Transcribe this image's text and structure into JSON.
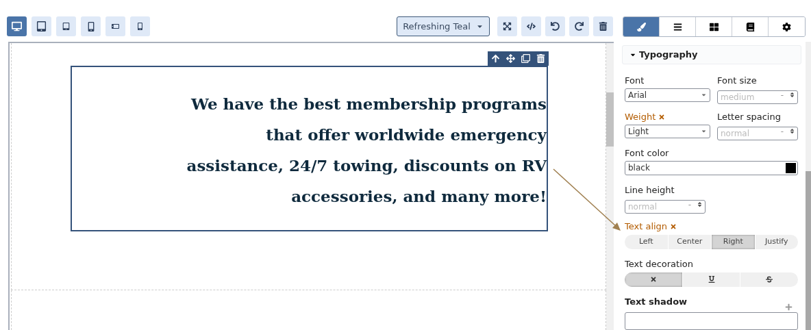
{
  "device_buttons": [
    {
      "kind": "desktop",
      "selected": true
    },
    {
      "kind": "tablet",
      "selected": false
    },
    {
      "kind": "tablet-small",
      "selected": false
    },
    {
      "kind": "phone",
      "selected": false
    },
    {
      "kind": "phone-landscape",
      "selected": false
    },
    {
      "kind": "phone-small",
      "selected": false
    }
  ],
  "theme_dropdown": {
    "value": "Refreshing Teal"
  },
  "toolbar": [
    {
      "kind": "fullscreen"
    },
    {
      "kind": "code"
    },
    {
      "kind": "undo"
    },
    {
      "kind": "redo"
    },
    {
      "kind": "delete"
    }
  ],
  "panel_tabs": [
    {
      "kind": "style",
      "selected": true
    },
    {
      "kind": "layers",
      "selected": false
    },
    {
      "kind": "blocks",
      "selected": false
    },
    {
      "kind": "pages",
      "selected": false
    },
    {
      "kind": "settings",
      "selected": false
    }
  ],
  "canvas": {
    "block_toolbar": [
      {
        "kind": "up"
      },
      {
        "kind": "move"
      },
      {
        "kind": "clone"
      },
      {
        "kind": "delete"
      }
    ],
    "text_block": {
      "text": "We have the best membership programs that offer worldwide emergency assistance, 24/7 towing, discounts on RV accessories, and many more!",
      "selected": true
    }
  },
  "typography": {
    "title": "Typography",
    "expanded": true,
    "rows": [
      [
        {
          "kind": "select",
          "label": "Font",
          "modified": false,
          "value": "Arial"
        },
        {
          "kind": "number",
          "label": "Font size",
          "modified": false,
          "placeholder": "medium",
          "unit": "-"
        }
      ],
      [
        {
          "kind": "select",
          "label": "Weight",
          "modified": true,
          "value": "Light"
        },
        {
          "kind": "number",
          "label": "Letter spacing",
          "modified": false,
          "placeholder": "normal",
          "unit": "-"
        }
      ],
      [
        {
          "kind": "color",
          "label": "Font color",
          "modified": false,
          "value": "black",
          "color": "#000000"
        }
      ],
      [
        {
          "kind": "number",
          "label": "Line height",
          "modified": false,
          "placeholder": "normal",
          "unit": "-"
        }
      ],
      [
        {
          "kind": "radio",
          "label": "Text align",
          "modified": true,
          "options": [
            {
              "label": "Left",
              "selected": false
            },
            {
              "label": "Center",
              "selected": false
            },
            {
              "label": "Right",
              "selected": true
            },
            {
              "label": "Justify",
              "selected": false
            }
          ]
        }
      ],
      [
        {
          "kind": "icon-radio",
          "label": "Text decoration",
          "modified": false,
          "options": [
            {
              "kind": "none",
              "selected": true
            },
            {
              "kind": "underline",
              "selected": false
            },
            {
              "kind": "strikethrough",
              "selected": false
            }
          ]
        }
      ],
      [
        {
          "kind": "stack",
          "label": "Text shadow",
          "modified": false
        }
      ]
    ]
  }
}
